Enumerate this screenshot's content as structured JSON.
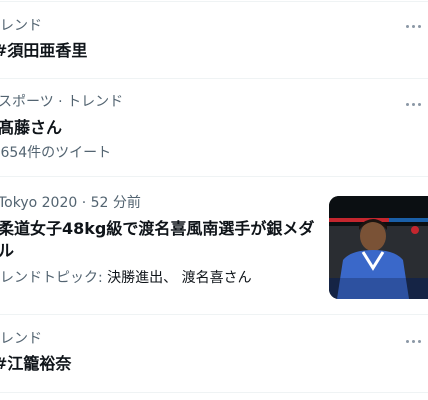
{
  "trends": [
    {
      "context": "トレンド",
      "title": "#須田亜香里"
    },
    {
      "context": "スポーツ · トレンド",
      "title": "髙藤さん",
      "count": ",654件のツイート"
    },
    {
      "context": "トレンド",
      "title": "#江籠裕奈"
    }
  ],
  "news": {
    "source": "Tokyo 2020",
    "time": " · 52 分前",
    "headline": "柔道女子48kg級で渡名喜風南選手が銀メダル",
    "topic_label": "トレンドトピック: ",
    "topic_items": "決勝進出、 渡名喜さん"
  },
  "icons": {
    "more": "more-dots-icon"
  },
  "colors": {
    "secondary_text": "#536471",
    "primary_text": "#0f1419",
    "divider": "#eff3f4"
  }
}
